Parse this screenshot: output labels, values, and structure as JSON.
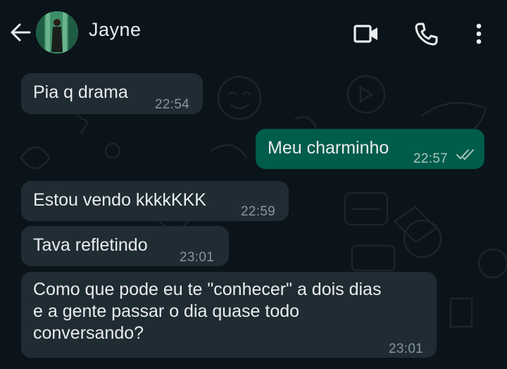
{
  "header": {
    "contact_name": "Jayne",
    "icons": [
      "back-arrow-icon",
      "avatar",
      "video-call-icon",
      "voice-call-icon",
      "more-options-icon"
    ]
  },
  "colors": {
    "background": "#0b141a",
    "incoming_bubble": "#202c33",
    "outgoing_bubble": "#005c4b",
    "text": "#e9edef",
    "timestamp": "#8696a0"
  },
  "messages": [
    {
      "direction": "in",
      "text": "Pia q drama",
      "time": "22:54"
    },
    {
      "direction": "out",
      "text": "Meu charminho",
      "time": "22:57",
      "status": "delivered"
    },
    {
      "direction": "in",
      "text": "Estou vendo kkkkKKK",
      "time": "22:59"
    },
    {
      "direction": "in",
      "text": "Tava refletindo",
      "time": "23:01"
    },
    {
      "direction": "in",
      "text": "Como que pode eu te \"conhecer\" a dois dias\ne a gente passar o dia quase todo\nconversando?",
      "time": "23:01"
    }
  ]
}
